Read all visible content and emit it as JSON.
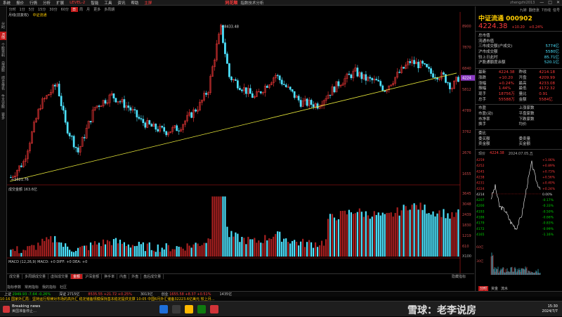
{
  "menubar": {
    "items": [
      "系统",
      "报价",
      "行情",
      "分析",
      "扩展",
      "LEVEL-2",
      "智能",
      "工具",
      "资讯",
      "帮助"
    ],
    "highlight": "主屏",
    "brand": "同花顺",
    "tip": "指数技术分析",
    "user": "zhengzhi2013",
    "window_buttons": [
      "—",
      "□",
      "✕"
    ]
  },
  "periods": {
    "items": [
      "分时",
      "1分",
      "5分",
      "15分",
      "30分",
      "60分",
      "日",
      "周",
      "月",
      "更多",
      "多周期"
    ],
    "active": "日",
    "right": [
      "九转",
      "翻倍涨",
      "7日线",
      "信号"
    ]
  },
  "vtabs": [
    "分时",
    "K线",
    "个股资料",
    "自选股",
    "综合排名",
    "牛叉诊股",
    "更多"
  ],
  "vtabs_active": "K线",
  "main": {
    "label_left": "月线(前复权)",
    "label_right": "中证流通",
    "y_ticks": [
      "8900",
      "7870",
      "6840",
      "5812",
      "4789",
      "3762",
      "2676",
      "1655"
    ],
    "current_price_tag": "4224",
    "high_annot": "8433.48",
    "low_annot": "1021.76",
    "colors": {
      "up": "#ff3b3b",
      "down": "#4de3ff",
      "trend": "#e8e83a"
    }
  },
  "volume": {
    "label": "成交金额  163.6亿",
    "y_ticks": [
      "3645",
      "3048",
      "2439",
      "1830",
      "1219",
      "610"
    ],
    "unit": "X100"
  },
  "macd": {
    "label": "MACD (12,26,9)  MACD: +0 DIFF: +0 DEA: +0"
  },
  "indicator_tabs": [
    "成交量",
    "多周期成交量",
    "虚拟成交量",
    "金额",
    "沪深金额",
    "换手率",
    "内盘",
    "外盘",
    "盘后成交量"
  ],
  "indicator_active": "金额",
  "indicator_right": "隐藏指标",
  "bottom_tabs": [
    "指标参数",
    "常用指标",
    "我的指标",
    "社区"
  ],
  "indexbar": [
    {
      "name": "上证",
      "val": "2949.93",
      "chg": "-7.64",
      "pct": "-0.26%",
      "dir": "down"
    },
    {
      "name": "深证",
      "val": "2715亿",
      "chg": "",
      "pct": "",
      "dir": "flat"
    },
    {
      "name": "",
      "val": "8535.55",
      "chg": "+21.72",
      "pct": "+0.25%",
      "dir": "up"
    },
    {
      "name": "",
      "val": "3013亿",
      "chg": "",
      "pct": "",
      "dir": "flat"
    },
    {
      "name": "创业",
      "val": "1655.58",
      "chg": "+8.37",
      "pct": "+0.51%",
      "dir": "up"
    },
    {
      "name": "",
      "val": "1435亿",
      "chg": "",
      "pct": "",
      "dir": "flat"
    }
  ],
  "marquee": "10:16 国家外汇局：坚持运行规律对市场的高外汇  稳定储备规模保持基本稳定提供支撑          10:05 中国6月外汇储备32223.6亿美元 较上月…",
  "taskbar": {
    "news_title": "Breaking news",
    "news_sub": "美国准备停止…",
    "watermark": "雪球：老李说房",
    "time": "15:30",
    "date": "2024/7/7"
  },
  "right": {
    "top_links": [
      "九转",
      "翻倍涨",
      "7日线",
      "信号"
    ],
    "name": "中证流通  000902",
    "price": "4224.38",
    "chg": "+10.20",
    "pct": "+0.24%",
    "info": [
      {
        "k": "总市值",
        "v": ""
      },
      {
        "k": "流通市值",
        "v": ""
      },
      {
        "k": "三市成交额(户成交)",
        "v": "5774亿"
      },
      {
        "k": "沪市成交额",
        "v": "5580亿"
      },
      {
        "k": "较上日此时",
        "v": "85.71亿"
      },
      {
        "k": "沪股通额度余额",
        "v": "520.1亿"
      }
    ],
    "quote": [
      [
        "最新",
        "4224.38",
        "昨收",
        "4214.18"
      ],
      [
        "涨跌",
        "+10.20",
        "开盘",
        "4209.99"
      ],
      [
        "涨幅",
        "+0.24%",
        "最高",
        "4233.08"
      ],
      [
        "振幅",
        "1.44%",
        "最低",
        "4172.32"
      ],
      [
        "现手",
        "18756万",
        "量比",
        "0.91"
      ],
      [
        "总手",
        "55588万",
        "金额",
        "5584亿"
      ]
    ],
    "breadth": [
      [
        "市盈",
        "",
        "上涨家数",
        ""
      ],
      [
        "市盈(动)",
        "",
        "平盘家数",
        ""
      ],
      [
        "市净率",
        "",
        "下跌家数",
        ""
      ],
      [
        "换手",
        "",
        "均价",
        ""
      ]
    ],
    "orders": [
      [
        "委比",
        "",
        "",
        ""
      ],
      [
        "委买额",
        "",
        "委卖量",
        ""
      ],
      [
        "卖金额",
        "",
        "买金额",
        ""
      ]
    ],
    "mini_label_left": "现价",
    "mini_label_mid": "4224.38",
    "mini_label_right": "2024.07.05,五",
    "mini_ticks_left": [
      "4259",
      "4252",
      "4245",
      "4238",
      "4231",
      "4224",
      "4214",
      "4207",
      "4200",
      "4193",
      "4186",
      "4179",
      "4172",
      "4165"
    ],
    "mini_ticks_right": [
      "+1.06%",
      "+0.89%",
      "+0.73%",
      "+0.56%",
      "+0.40%",
      "+0.24%",
      "0.00%",
      "-0.17%",
      "-0.33%",
      "-0.50%",
      "-0.66%",
      "-0.83%",
      "-0.99%",
      "-1.16%"
    ],
    "mini_vol_ticks": [
      "60亿",
      "30亿"
    ],
    "bottom_tabs": [
      "分时",
      "资金",
      "流水"
    ],
    "bottom_active": "分时"
  }
}
